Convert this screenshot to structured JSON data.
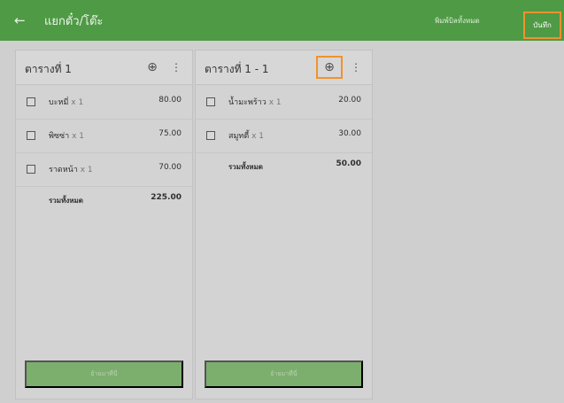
{
  "appbar": {
    "back_icon": "←",
    "title": "แยกตั๋ว/โต๊ะ",
    "print_all_label": "พิมพ์บิลทั้งหมด",
    "save_label": "บันทึก",
    "colors": {
      "bar": "#4f9a45",
      "highlight": "#f0922d"
    }
  },
  "tables": [
    {
      "title": "ตารางที่ 1",
      "add_icon": "⊕",
      "more_icon": "⋮",
      "items": [
        {
          "name": "บะหมี่",
          "qty": "x 1",
          "price": "80.00"
        },
        {
          "name": "พิซซ่า",
          "qty": "x 1",
          "price": "75.00"
        },
        {
          "name": "ราดหน้า",
          "qty": "x 1",
          "price": "70.00"
        }
      ],
      "total_label": "รวมทั้งหมด",
      "total_value": "225.00",
      "move_button_label": "ย้ายมาที่นี่"
    },
    {
      "title": "ตารางที่ 1 - 1",
      "add_icon": "⊕",
      "more_icon": "⋮",
      "items": [
        {
          "name": "น้ำมะพร้าว",
          "qty": "x 1",
          "price": "20.00"
        },
        {
          "name": "สมูทตี้",
          "qty": "x 1",
          "price": "30.00"
        }
      ],
      "total_label": "รวมทั้งหมด",
      "total_value": "50.00",
      "move_button_label": "ย้ายมาที่นี่"
    }
  ]
}
